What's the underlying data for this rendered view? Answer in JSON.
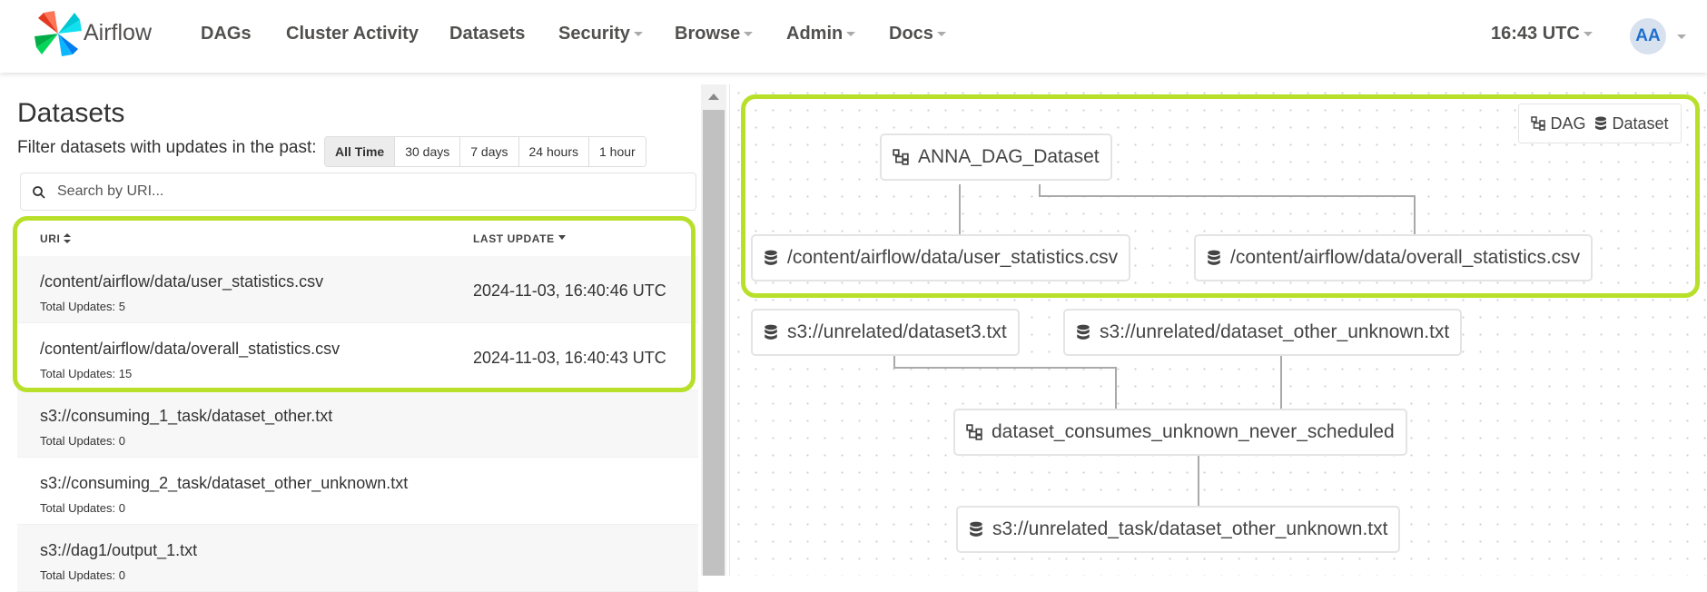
{
  "nav": {
    "brand": "Airflow",
    "items": [
      "DAGs",
      "Cluster Activity",
      "Datasets",
      "Security",
      "Browse",
      "Admin",
      "Docs"
    ],
    "clock": "16:43 UTC",
    "avatar": "AA"
  },
  "page": {
    "title": "Datasets",
    "filter_label": "Filter datasets with updates in the past:",
    "filters": [
      "All Time",
      "30 days",
      "7 days",
      "24 hours",
      "1 hour"
    ],
    "active_filter": "All Time",
    "search_placeholder": "Search by URI..."
  },
  "table": {
    "headers": {
      "uri": "URI",
      "last_update": "LAST UPDATE"
    },
    "rows": [
      {
        "uri": "/content/airflow/data/user_statistics.csv",
        "updates": "Total Updates: 5",
        "last_update": "2024-11-03, 16:40:46 UTC"
      },
      {
        "uri": "/content/airflow/data/overall_statistics.csv",
        "updates": "Total Updates: 15",
        "last_update": "2024-11-03, 16:40:43 UTC"
      },
      {
        "uri": "s3://consuming_1_task/dataset_other.txt",
        "updates": "Total Updates: 0",
        "last_update": ""
      },
      {
        "uri": "s3://consuming_2_task/dataset_other_unknown.txt",
        "updates": "Total Updates: 0",
        "last_update": ""
      },
      {
        "uri": "s3://dag1/output_1.txt",
        "updates": "Total Updates: 0",
        "last_update": ""
      }
    ]
  },
  "graph": {
    "legend": {
      "dag": "DAG",
      "dataset": "Dataset"
    },
    "nodes": {
      "anna_dag": "ANNA_DAG_Dataset",
      "user_stats": "/content/airflow/data/user_statistics.csv",
      "overall_stats": "/content/airflow/data/overall_statistics.csv",
      "dataset3": "s3://unrelated/dataset3.txt",
      "other_unknown": "s3://unrelated/dataset_other_unknown.txt",
      "consumes_dag": "dataset_consumes_unknown_never_scheduled",
      "task_other_unknown": "s3://unrelated_task/dataset_other_unknown.txt"
    }
  },
  "colors": {
    "highlight": "#b8e02a",
    "link": "#1f6fce"
  }
}
